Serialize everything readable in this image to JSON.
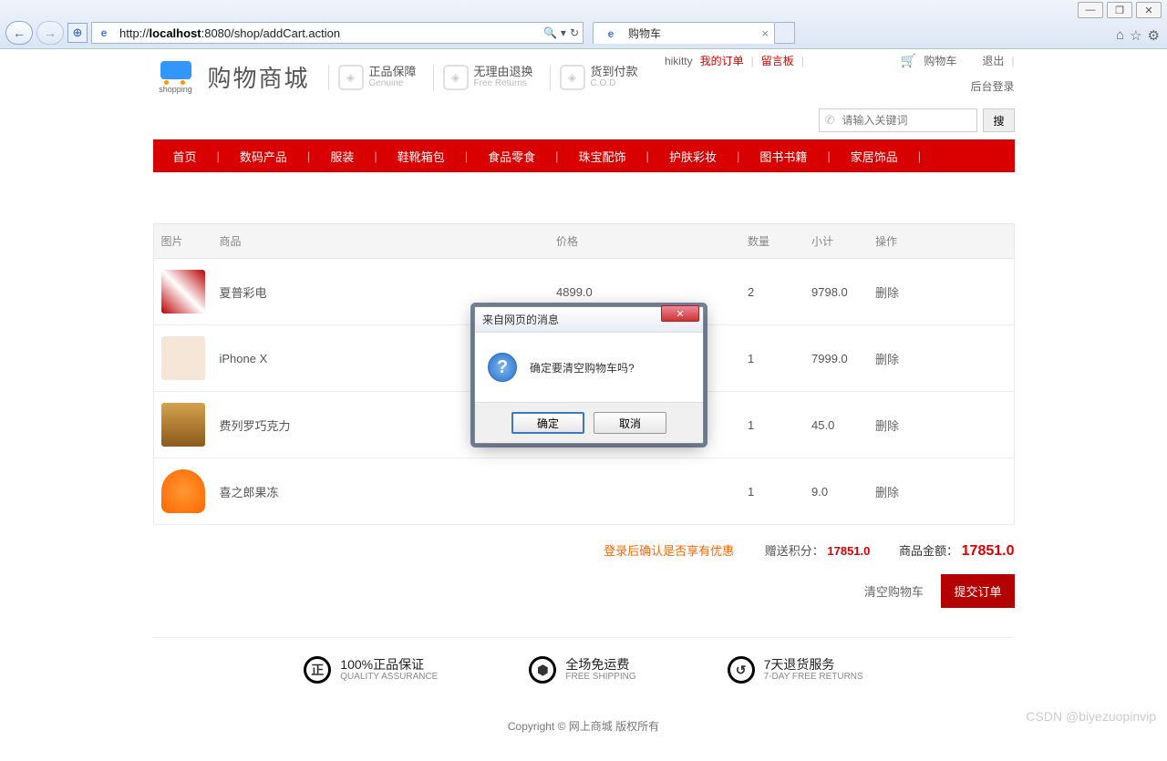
{
  "browser": {
    "url_prefix": "http://",
    "url_host": "localhost",
    "url_port_path": ":8080/shop/addCart.action",
    "tab_title": "购物车",
    "window_min": "—",
    "window_max": "❐",
    "window_close": "✕"
  },
  "header": {
    "logo_text": "购物商城",
    "logo_sub": "shopping",
    "badges": [
      {
        "cn": "正品保障",
        "en": "Genuine"
      },
      {
        "cn": "无理由退换",
        "en": "Free Returns"
      },
      {
        "cn": "货到付款",
        "en": "C.O.D"
      }
    ],
    "top_user": "hikitty",
    "top_my_orders": "我的订单",
    "top_board": "留言板",
    "top_cart": "购物车",
    "top_logout": "退出",
    "admin_login": "后台登录",
    "search_placeholder": "请输入关键词",
    "search_btn": "搜"
  },
  "nav": [
    "首页",
    "数码产品",
    "服装",
    "鞋靴箱包",
    "食品零食",
    "珠宝配饰",
    "护肤彩妆",
    "图书书籍",
    "家居饰品"
  ],
  "table": {
    "headers": {
      "img": "图片",
      "name": "商品",
      "price": "价格",
      "qty": "数量",
      "subtotal": "小计",
      "op": "操作"
    },
    "rows": [
      {
        "img_class": "img-tv",
        "name": "夏普彩电",
        "price": "4899.0",
        "qty": "2",
        "subtotal": "9798.0",
        "op": "删除"
      },
      {
        "img_class": "img-phone",
        "name": "iPhone X",
        "price": "",
        "qty": "1",
        "subtotal": "7999.0",
        "op": "删除"
      },
      {
        "img_class": "img-choc",
        "name": "费列罗巧克力",
        "price": "",
        "qty": "1",
        "subtotal": "45.0",
        "op": "删除"
      },
      {
        "img_class": "img-jelly",
        "name": "喜之郎果冻",
        "price": "",
        "qty": "1",
        "subtotal": "9.0",
        "op": "删除"
      }
    ]
  },
  "summary": {
    "login_hint": "登录后确认是否享有优惠",
    "points_label": "赠送积分：",
    "points_value": "17851.0",
    "total_label": "商品金额：",
    "total_value": "17851.0"
  },
  "actions": {
    "clear": "清空购物车",
    "submit": "提交订单"
  },
  "footer_badges": [
    {
      "cn": "100%正品保证",
      "en": "QUALITY ASSURANCE",
      "icon": "正"
    },
    {
      "cn": "全场免运费",
      "en": "FREE SHIPPING",
      "icon": "⬢"
    },
    {
      "cn": "7天退货服务",
      "en": "7-DAY FREE RETURNS",
      "icon": "↺"
    }
  ],
  "copyright": "Copyright © 网上商城 版权所有",
  "dialog": {
    "title": "来自网页的消息",
    "message": "确定要清空购物车吗?",
    "ok": "确定",
    "cancel": "取消"
  },
  "watermark": "CSDN @biyezuopinvip"
}
